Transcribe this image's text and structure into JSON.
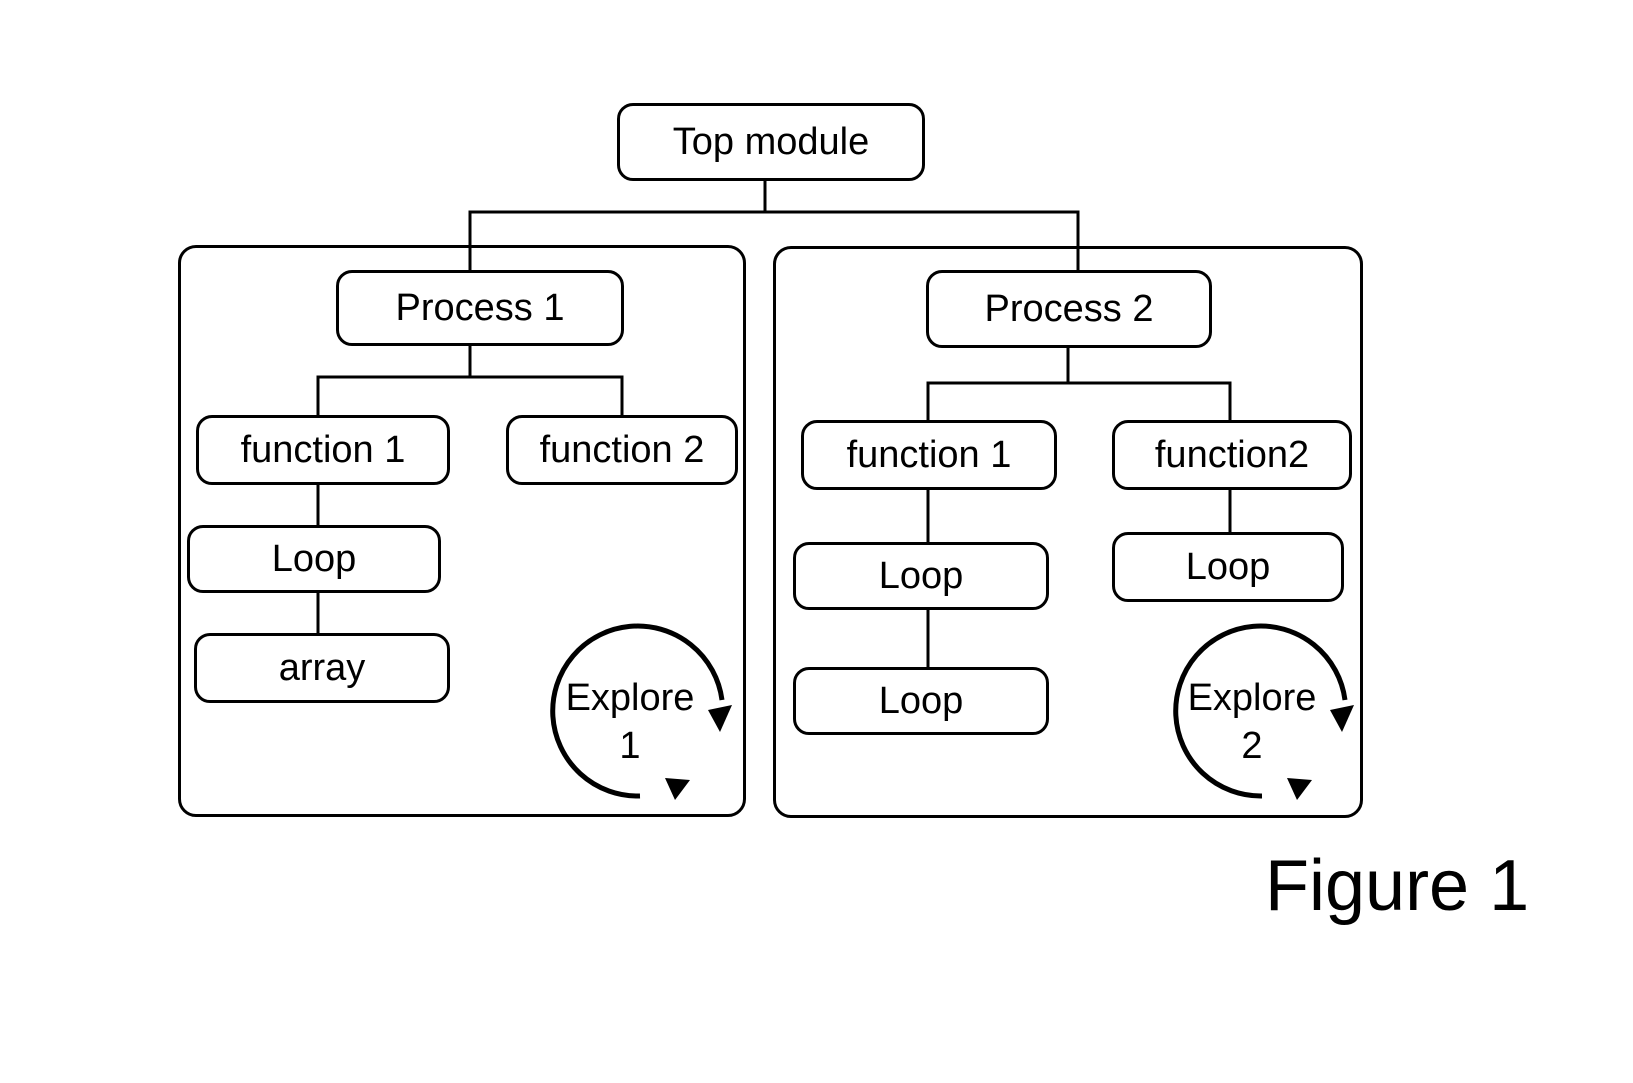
{
  "top": {
    "label": "Top module"
  },
  "process1": {
    "label": "Process 1",
    "function1": "function 1",
    "function2": "function 2",
    "loop": "Loop",
    "array": "array",
    "explore": {
      "line1": "Explore",
      "line2": "1"
    }
  },
  "process2": {
    "label": "Process 2",
    "function1": "function 1",
    "function2": "function2",
    "loop_a": "Loop",
    "loop_b": "Loop",
    "loop_c": "Loop",
    "explore": {
      "line1": "Explore",
      "line2": "2"
    }
  },
  "caption": "Figure 1"
}
